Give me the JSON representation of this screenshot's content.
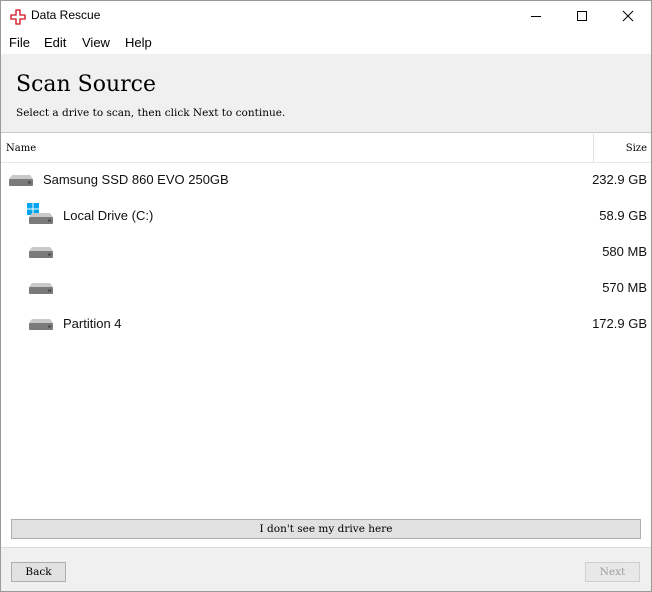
{
  "window": {
    "title": "Data Rescue",
    "icon": "red-cross-icon",
    "controls": [
      "minimize-icon",
      "maximize-icon",
      "close-icon"
    ]
  },
  "menu": {
    "items": [
      {
        "label": "File"
      },
      {
        "label": "Edit"
      },
      {
        "label": "View"
      },
      {
        "label": "Help"
      }
    ]
  },
  "header": {
    "title": "Scan Source",
    "subtitle": "Select a drive to scan, then click Next to continue."
  },
  "list": {
    "columns": {
      "name": "Name",
      "size": "Size"
    },
    "rows": [
      {
        "name": "Samsung SSD 860 EVO 250GB",
        "size": "232.9 GB",
        "level": 0,
        "icon": "hard-drive-icon"
      },
      {
        "name": "Local Drive (C:)",
        "size": "58.9 GB",
        "level": 1,
        "icon": "windows-drive-icon"
      },
      {
        "name": "",
        "size": "580 MB",
        "level": 1,
        "icon": "hard-drive-icon"
      },
      {
        "name": "",
        "size": "570 MB",
        "level": 1,
        "icon": "hard-drive-icon"
      },
      {
        "name": "Partition 4",
        "size": "172.9 GB",
        "level": 1,
        "icon": "hard-drive-icon"
      }
    ]
  },
  "buttons": {
    "no_drive": "I don't see my drive here",
    "back": "Back",
    "next": "Next"
  },
  "colors": {
    "brand_red": "#d9333f",
    "header_bg": "#f0f0f0",
    "windows_blue": "#00a4ef"
  }
}
